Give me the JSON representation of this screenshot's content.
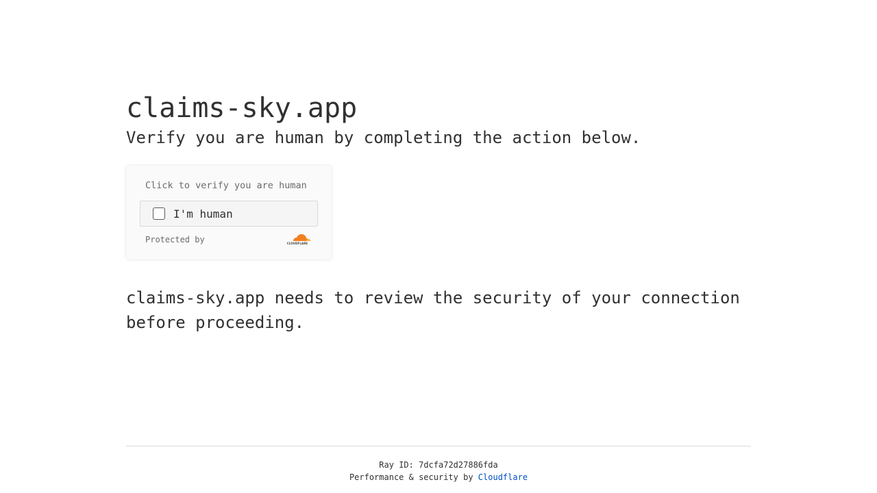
{
  "header": {
    "site_title": "claims-sky.app",
    "subtitle": "Verify you are human by completing the action below."
  },
  "widget": {
    "prompt": "Click to verify you are human",
    "checkbox_label": "I'm human",
    "checkbox_checked": false,
    "protected_by": "Protected by",
    "logo_text": "CLOUDFLARE",
    "logo_icon": "cloudflare-cloud-icon"
  },
  "body": {
    "review_text": "claims-sky.app needs to review the security of your connection before proceeding."
  },
  "footer": {
    "ray_label": "Ray ID:",
    "ray_id": "7dcfa72d27886fda",
    "performance_text": "Performance & security by",
    "cloudflare_link": "Cloudflare"
  },
  "colors": {
    "text": "#313131",
    "link": "#0051c3",
    "cloudflare_orange": "#f38020",
    "cloudflare_light_orange": "#faae40"
  }
}
